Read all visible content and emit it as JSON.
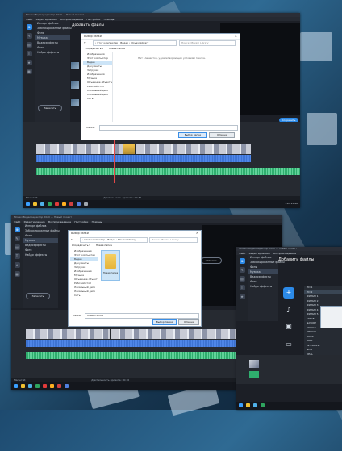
{
  "app": {
    "title": "Movavi Видеоредактор 2020 — Новый проект",
    "menu": [
      "Файл",
      "Редактирование",
      "Воспроизведение",
      "Настройки",
      "Помощь"
    ],
    "nav": [
      "Импорт файлов",
      "Заблокированные файлы",
      "Фоны",
      "Музыка",
      "Видеоэффекты",
      "Фото",
      "Найди эффекты"
    ],
    "add_files_title": "Добавить файлы",
    "record_button": "Записать",
    "export_button": "Сохранить",
    "status_text": "Масштаб:",
    "duration_label": "Длительность проекта: 00:36",
    "timecode": "00:00:16"
  },
  "dialog1": {
    "title": "Выбор папки",
    "breadcrumb": "› Этот компьютер › Видео › Movavi Library",
    "search_placeholder": "Поиск: Movavi Library",
    "organize_label": "Упорядочить ▾",
    "new_folder_label": "Новая папка",
    "tree": [
      "Изображения",
      "Этот компьютер",
      "Видео",
      "Документы",
      "Загрузки",
      "Изображения",
      "Музыка",
      "Объемные объекты",
      "Рабочий стол",
      "Локальный диск",
      "Локальный диск",
      "Сеть"
    ],
    "empty_message": "Нет элементов, удовлетворяющих условиям поиска.",
    "folder_label": "Папка:",
    "folder_value": "",
    "select_button": "Выбор папки",
    "cancel_button": "Отмена"
  },
  "dialog2": {
    "title": "Выбор папки",
    "breadcrumb": "› Этот компьютер › Видео › Movavi Library",
    "search_placeholder": "Поиск: Movavi Library",
    "organize_label": "Упорядочить ▾",
    "new_folder_label": "Новая папка",
    "tree": [
      "Изображения",
      "Этот компьютер",
      "Видео",
      "Документы",
      "Загрузки",
      "Изображения",
      "Музыка",
      "Объемные объекты",
      "Рабочий стол",
      "Локальный диск",
      "Локальный диск",
      "Сеть"
    ],
    "folder_item_label": "Новая папка",
    "folder_label": "Папка:",
    "folder_value": "Новая папка",
    "select_button": "Выбор папки",
    "cancel_button": "Отмена"
  },
  "panel3": {
    "title": "Добавить файлы",
    "list": [
      "Импорт файлов",
      "Заблокированные файлы",
      "Фоны",
      "Музыка",
      "Видеоэффекты",
      "Фото",
      "Найди эффекты"
    ],
    "submenu": [
      "HD 1",
      "HD 2",
      "ФИЛЬМ 1",
      "ФИЛЬМ 2",
      "ФИЛЬМ 3",
      "ФИЛЬМ 4",
      "ФИЛЬМ 5",
      "SPACE",
      "NATURE",
      "MOVAVI",
      "DESIGN",
      "BOOK",
      "SALE",
      "INTERVIEW",
      "NEW",
      "DEAL"
    ]
  },
  "taskbar": {
    "time": "15:40",
    "date": "04.02.2020",
    "lang": "РУС"
  },
  "colors": {
    "accent": "#2c8ae8",
    "background_dark": "#1c1f26",
    "video_track": "#c9ccd6",
    "audio_track": "#4f86e8",
    "music_track": "#2fae6e"
  }
}
